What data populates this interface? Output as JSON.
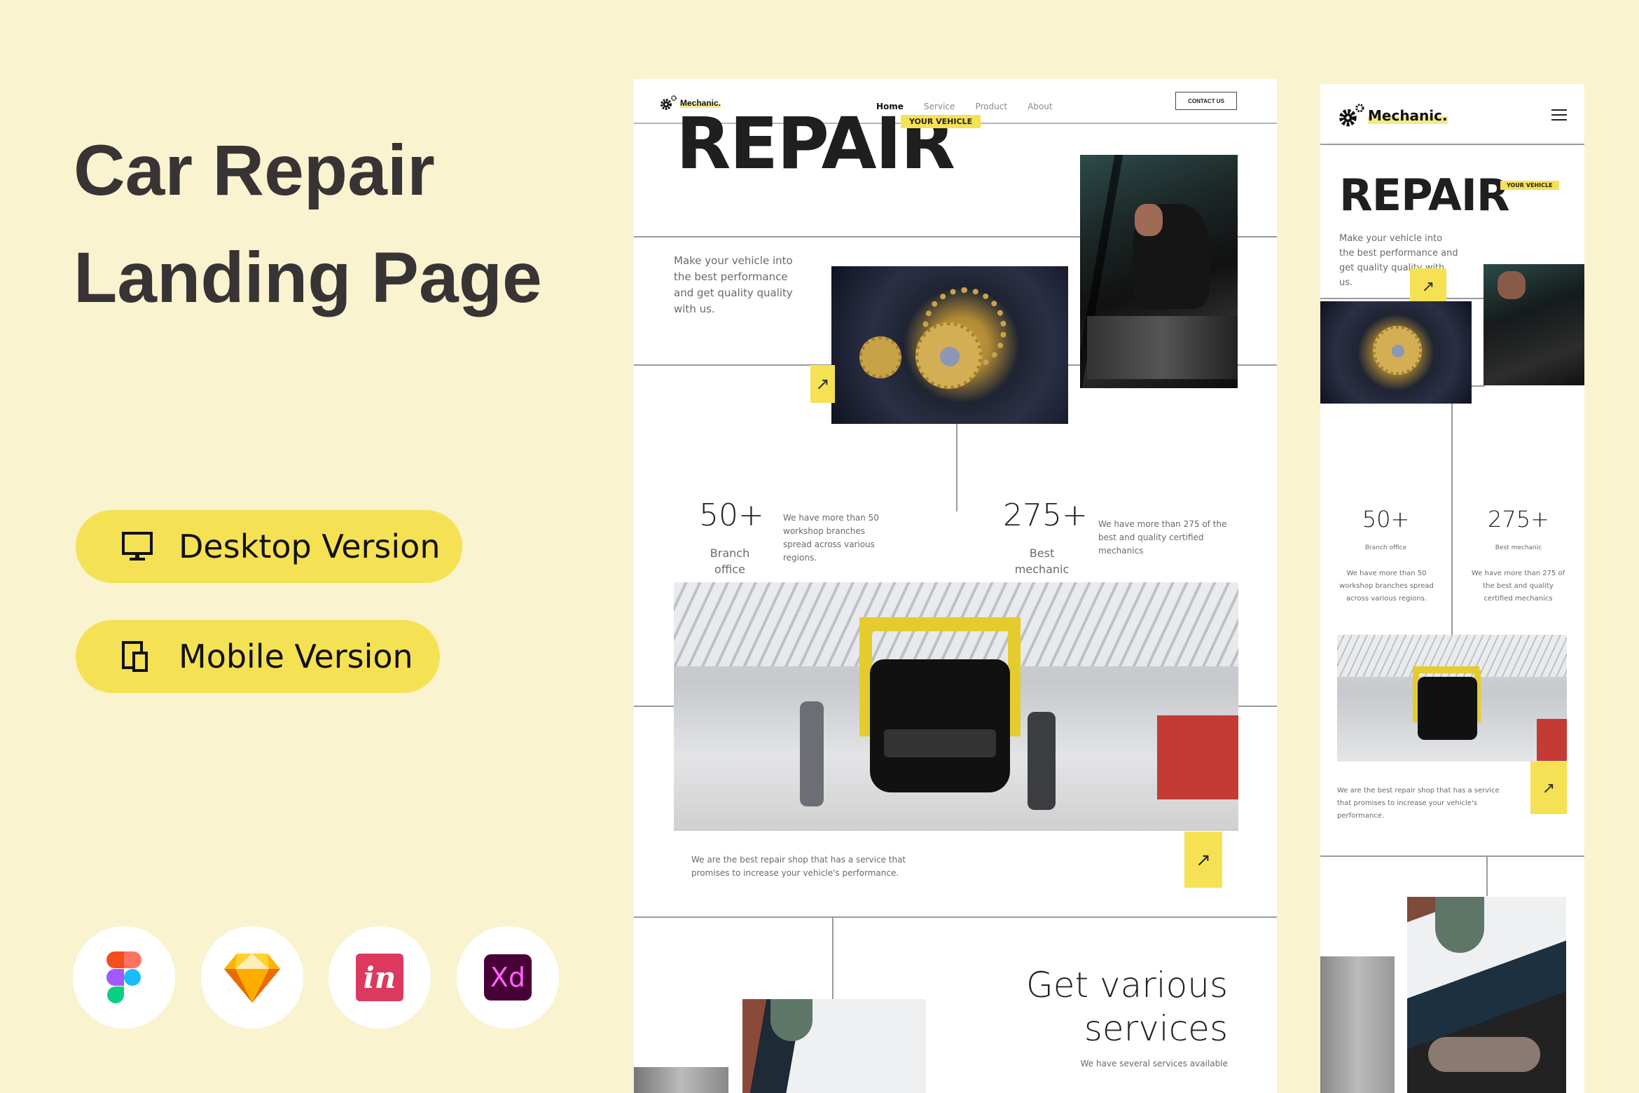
{
  "hero": {
    "title_line1": "Car Repair",
    "title_line2": "Landing Page"
  },
  "versions": [
    {
      "label": "Desktop Version",
      "icon": "desktop-monitor-icon"
    },
    {
      "label": "Mobile Version",
      "icon": "mobile-devices-icon"
    }
  ],
  "tools": [
    {
      "name": "Figma",
      "icon": "figma-icon"
    },
    {
      "name": "Sketch",
      "icon": "sketch-icon"
    },
    {
      "name": "InVision",
      "icon": "invision-icon",
      "glyph": "in"
    },
    {
      "name": "Adobe XD",
      "icon": "adobe-xd-icon",
      "glyph": "Xd"
    }
  ],
  "colors": {
    "background": "#faf3cf",
    "accent_yellow": "#f5e154",
    "text_dark": "#383334",
    "invision": "#dc395f",
    "xd_bg": "#470137",
    "xd_text": "#ff61f6"
  },
  "desktop": {
    "brand": "Mechanic.",
    "nav": [
      "Home",
      "Service",
      "Product",
      "About"
    ],
    "nav_active": "Home",
    "contact_button": "CONTACT US",
    "headline": "REPAIR",
    "tag": "YOUR VEHICLE",
    "intro": "Make your vehicle into the best performance and get quality quality with us.",
    "stats": [
      {
        "value": "50+",
        "label": "Branch office",
        "description": "We have more than 50 workshop branches spread across various regions."
      },
      {
        "value": "275+",
        "label": "Best mechanic",
        "description": "We have more than 275 of the best and quality certified mechanics"
      }
    ],
    "about_text": "We are the best repair shop that has a service that promises to increase your vehicle's performance.",
    "services_title_line1": "Get various",
    "services_title_line2": "services",
    "services_subtitle": "We have several services available",
    "arrow_glyph": "↗"
  },
  "mobile": {
    "brand": "Mechanic.",
    "headline": "REPAIR",
    "tag": "YOUR VEHICLE",
    "intro": "Make your vehicle into the best performance and get quality quality with us.",
    "stats": [
      {
        "value": "50+",
        "label": "Branch office",
        "description": "We have more than 50 workshop branches spread across various regions."
      },
      {
        "value": "275+",
        "label": "Best mechanic",
        "description": "We have more than 275 of the best and quality certified mechanics"
      }
    ],
    "about_text": "We are the best repair shop that has a service that promises to increase your vehicle's performance.",
    "arrow_glyph": "↗"
  }
}
